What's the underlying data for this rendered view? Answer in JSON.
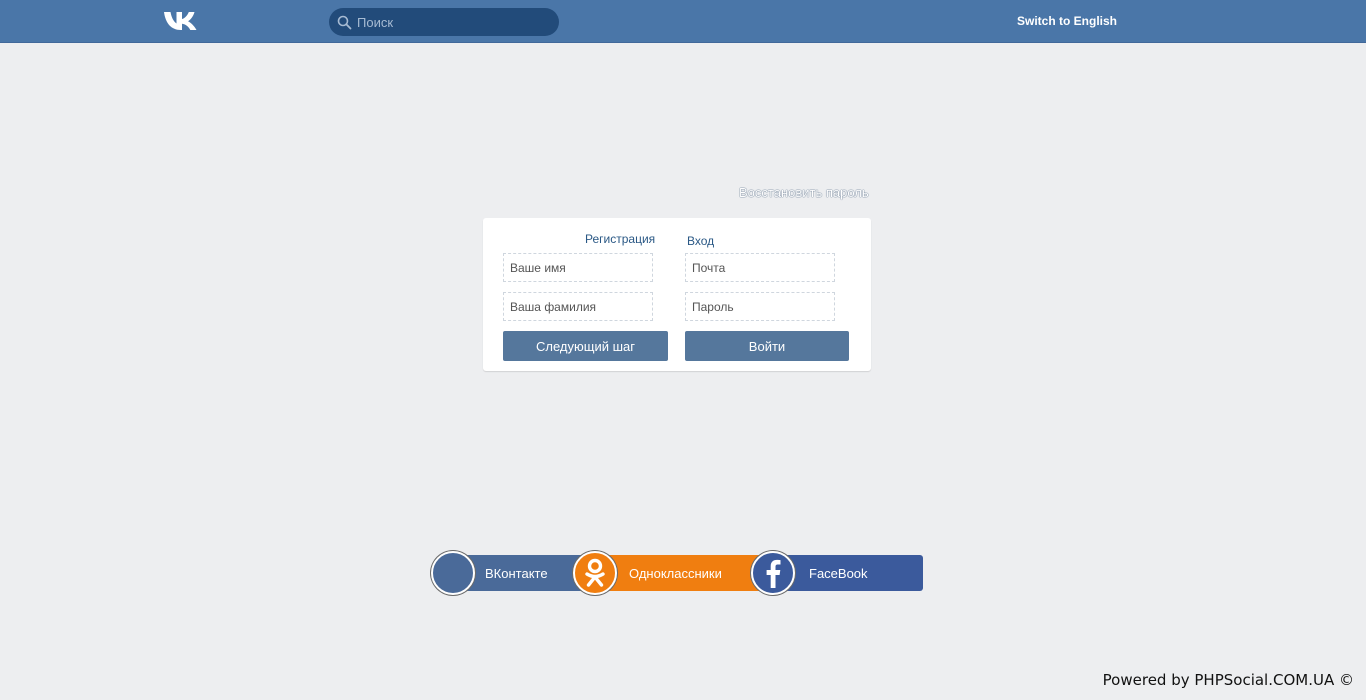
{
  "header": {
    "logo_icon": "vk-logo-icon",
    "search": {
      "placeholder": "Поиск",
      "value": "",
      "icon": "search-icon"
    },
    "language_switch": "Switch to English"
  },
  "restore_password": "Восстановить пароль",
  "registration": {
    "title": "Регистрация",
    "first_name_placeholder": "Ваше имя",
    "last_name_placeholder": "Ваша фамилия",
    "next_button": "Следующий шаг"
  },
  "login": {
    "title": "Вход",
    "email_placeholder": "Почта",
    "password_placeholder": "Пароль",
    "login_button": "Войти"
  },
  "social": [
    {
      "label": "ВКонтакте",
      "icon": "vk-circle-icon",
      "color": "#4a6a99"
    },
    {
      "label": "Одноклассники",
      "icon": "odnoklassniki-icon",
      "color": "#f07e10"
    },
    {
      "label": "FaceBook",
      "icon": "facebook-icon",
      "color": "#3b5a9c"
    }
  ],
  "footer": "Powered by PHPSocial.COM.UA ©",
  "colors": {
    "header_bg": "#4a76a8",
    "page_bg": "#edeef0",
    "button_bg": "#55779c",
    "link": "#2a5885"
  }
}
